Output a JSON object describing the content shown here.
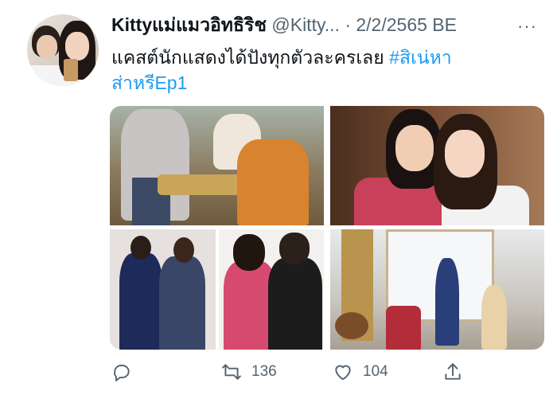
{
  "tweet": {
    "display_name": "Kittyแม่แมวอิทธิริช",
    "handle": "@Kitty...",
    "separator": "·",
    "date": "2/2/2565 BE",
    "more_label": "···",
    "text": "แคสต์นักแสดงได้ปังทุกตัวละครเลย ",
    "hashtag": "#สิเน่หาส่าหรีEp1"
  },
  "actions": {
    "reply_count": "",
    "retweet_count": "136",
    "like_count": "104"
  },
  "colors": {
    "link": "#1d9bf0",
    "secondary": "#536471",
    "text": "#0f1419"
  },
  "icons": [
    "reply-icon",
    "retweet-icon",
    "like-icon",
    "share-icon",
    "more-icon"
  ]
}
